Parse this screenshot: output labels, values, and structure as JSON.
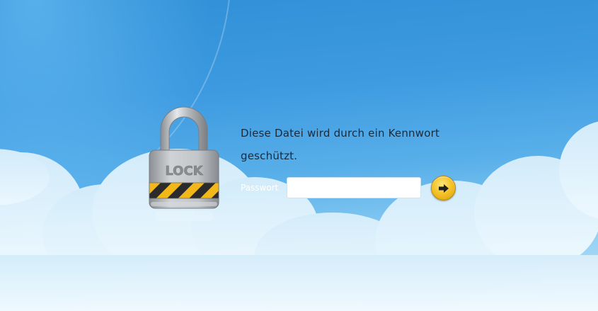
{
  "lock": {
    "label": "LOCK"
  },
  "message": {
    "line1": "Diese Datei wird durch ein Kennwort",
    "line2": "geschützt."
  },
  "password": {
    "label": "Passwort",
    "value": "",
    "placeholder": ""
  },
  "submit": {
    "icon": "arrow-right-icon"
  },
  "colors": {
    "sky_top": "#2f8fd6",
    "sky_bottom": "#bfe3f8",
    "button": "#f5c42a",
    "text": "#1c2a3a"
  }
}
